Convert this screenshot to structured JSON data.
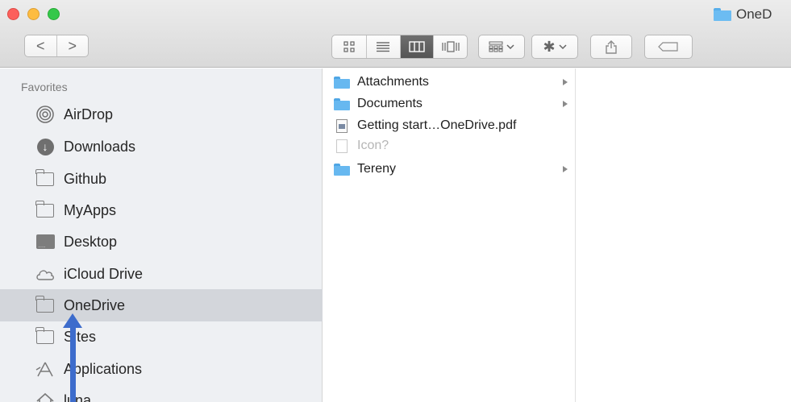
{
  "window": {
    "title": "OneD"
  },
  "toolbar": {
    "back_glyph": "<",
    "forward_glyph": ">",
    "action_glyph": "✱"
  },
  "sidebar": {
    "section_label": "Favorites",
    "items": [
      {
        "label": "AirDrop",
        "icon": "airdrop-icon"
      },
      {
        "label": "Downloads",
        "icon": "downloads-icon"
      },
      {
        "label": "Github",
        "icon": "folder-icon"
      },
      {
        "label": "MyApps",
        "icon": "folder-icon"
      },
      {
        "label": "Desktop",
        "icon": "desktop-icon"
      },
      {
        "label": "iCloud Drive",
        "icon": "cloud-icon"
      },
      {
        "label": "OneDrive",
        "icon": "folder-icon",
        "selected": true
      },
      {
        "label": "Sites",
        "icon": "folder-icon"
      },
      {
        "label": "Applications",
        "icon": "applications-icon"
      },
      {
        "label": "luna",
        "icon": "home-icon"
      }
    ]
  },
  "column": {
    "items": [
      {
        "label": "Attachments",
        "type": "folder",
        "has_children": true
      },
      {
        "label": "Documents",
        "type": "folder",
        "has_children": true
      },
      {
        "label": "Getting start…OneDrive.pdf",
        "type": "pdf",
        "has_children": false
      },
      {
        "label": "Icon?",
        "type": "file",
        "has_children": false,
        "muted": true
      },
      {
        "label": "Tereny",
        "type": "folder",
        "has_children": true
      }
    ]
  },
  "colors": {
    "accent_arrow": "#3d6ccc",
    "folder_blue": "#67b8f0",
    "sidebar_bg": "#eef0f3",
    "selected_bg": "#d3d6db"
  }
}
